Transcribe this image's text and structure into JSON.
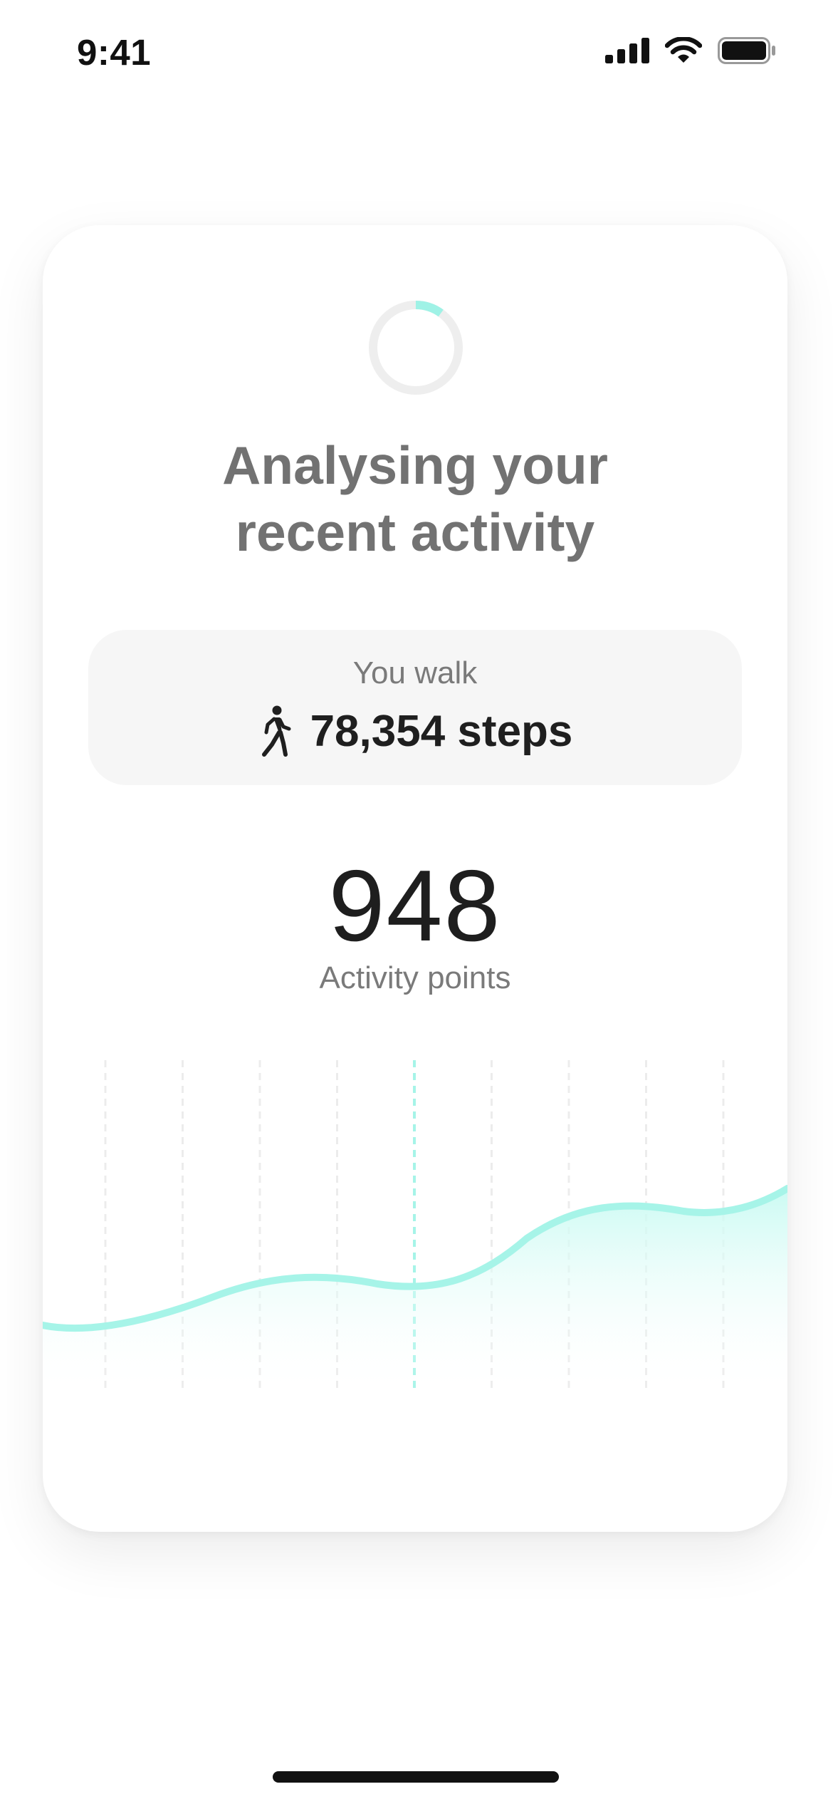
{
  "status_bar": {
    "time": "9:41",
    "icons": [
      "cellular-signal-icon",
      "wifi-icon",
      "battery-icon"
    ]
  },
  "loading": {
    "icon": "loading-spinner-icon",
    "progress": 0.1,
    "accent_color": "#9ff2e6",
    "track_color": "#eeeeee"
  },
  "title": {
    "line1": "Analysing your",
    "line2": "recent activity"
  },
  "steps": {
    "label": "You walk",
    "icon": "walking-person-icon",
    "value": "78,354 steps"
  },
  "points": {
    "value": "948",
    "label": "Activity points"
  },
  "chart": {
    "type": "area",
    "line_color": "#a6f4e8",
    "highlight_gridline_index": 4,
    "gridline_count": 9
  },
  "colors": {
    "accent": "#a6f4e8",
    "text_primary": "#1f1f1f",
    "text_secondary": "#727272"
  }
}
